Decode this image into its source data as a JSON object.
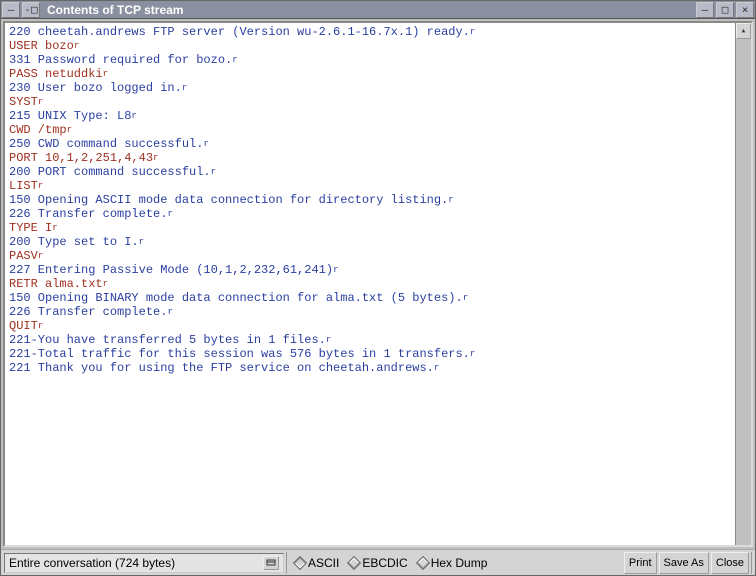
{
  "window": {
    "title": "Contents of TCP stream"
  },
  "stream": {
    "lines": [
      {
        "dir": "srv",
        "text": "220 cheetah.andrews FTP server (Version wu-2.6.1-16.7x.1) ready."
      },
      {
        "dir": "cli",
        "text": "USER bozo"
      },
      {
        "dir": "srv",
        "text": "331 Password required for bozo."
      },
      {
        "dir": "cli",
        "text": "PASS netuddki"
      },
      {
        "dir": "srv",
        "text": "230 User bozo logged in."
      },
      {
        "dir": "cli",
        "text": "SYST"
      },
      {
        "dir": "srv",
        "text": "215 UNIX Type: L8"
      },
      {
        "dir": "cli",
        "text": "CWD /tmp"
      },
      {
        "dir": "srv",
        "text": "250 CWD command successful."
      },
      {
        "dir": "cli",
        "text": "PORT 10,1,2,251,4,43"
      },
      {
        "dir": "srv",
        "text": "200 PORT command successful."
      },
      {
        "dir": "cli",
        "text": "LIST"
      },
      {
        "dir": "srv",
        "text": "150 Opening ASCII mode data connection for directory listing."
      },
      {
        "dir": "srv",
        "text": "226 Transfer complete."
      },
      {
        "dir": "cli",
        "text": "TYPE I"
      },
      {
        "dir": "srv",
        "text": "200 Type set to I."
      },
      {
        "dir": "cli",
        "text": "PASV"
      },
      {
        "dir": "srv",
        "text": "227 Entering Passive Mode (10,1,2,232,61,241)"
      },
      {
        "dir": "cli",
        "text": "RETR alma.txt"
      },
      {
        "dir": "srv",
        "text": "150 Opening BINARY mode data connection for alma.txt (5 bytes)."
      },
      {
        "dir": "srv",
        "text": "226 Transfer complete."
      },
      {
        "dir": "cli",
        "text": "QUIT"
      },
      {
        "dir": "srv",
        "text": "221-You have transferred 5 bytes in 1 files."
      },
      {
        "dir": "srv",
        "text": "221-Total traffic for this session was 576 bytes in 1 transfers."
      },
      {
        "dir": "srv",
        "text": "221 Thank you for using the FTP service on cheetah.andrews."
      }
    ],
    "cr_glyph": "r"
  },
  "toolbar": {
    "combo_label": "Entire conversation (724 bytes)",
    "radios": [
      {
        "label": "ASCII",
        "selected": true
      },
      {
        "label": "EBCDIC",
        "selected": false
      },
      {
        "label": "Hex Dump",
        "selected": false
      }
    ],
    "print": "Print",
    "save_as": "Save As",
    "close": "Close"
  }
}
